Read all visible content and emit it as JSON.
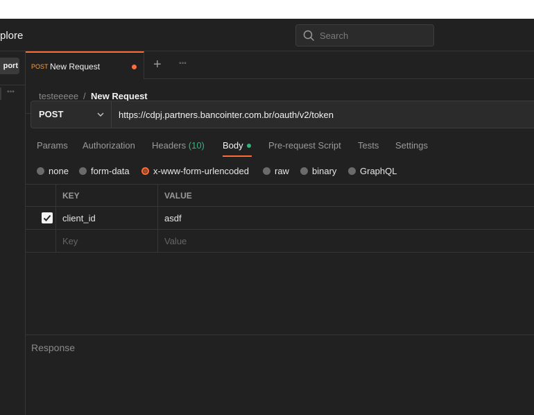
{
  "header": {
    "explore_label": "plore",
    "search_placeholder": "Search"
  },
  "sidebar": {
    "import_label": "port",
    "more_label": "°°°"
  },
  "tabs": {
    "active": {
      "method": "POST",
      "title": "New Request",
      "unsaved": true
    },
    "add_label": "+",
    "more_label": "°°°"
  },
  "breadcrumb": {
    "parent": "testeeeee",
    "separator": "/",
    "current": "New Request"
  },
  "request": {
    "method": "POST",
    "url": "https://cdpj.partners.bancointer.com.br/oauth/v2/token"
  },
  "request_tabs": {
    "params": "Params",
    "authorization": "Authorization",
    "headers": "Headers",
    "headers_count": "(10)",
    "body": "Body",
    "prerequest": "Pre-request Script",
    "tests": "Tests",
    "settings": "Settings",
    "active": "Body"
  },
  "body_types": {
    "none": "none",
    "form_data": "form-data",
    "urlencoded": "x-www-form-urlencoded",
    "raw": "raw",
    "binary": "binary",
    "graphql": "GraphQL",
    "selected": "x-www-form-urlencoded"
  },
  "table": {
    "headers": {
      "key": "KEY",
      "value": "VALUE"
    },
    "rows": [
      {
        "checked": true,
        "key": "client_id",
        "value": "asdf"
      }
    ],
    "new_row": {
      "key_placeholder": "Key",
      "value_placeholder": "Value"
    }
  },
  "response": {
    "title": "Response"
  },
  "colors": {
    "accent": "#ff6c37",
    "method_post": "#f4a04c",
    "success_green": "#2fb87a",
    "background": "#212121"
  },
  "icons": {
    "search": "search-icon",
    "chevron": "chevron-down-icon",
    "check": "check-icon"
  }
}
